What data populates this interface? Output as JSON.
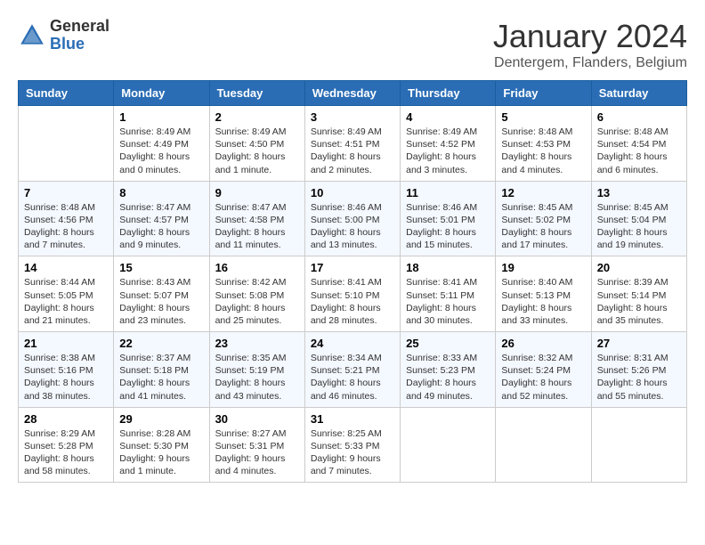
{
  "logo": {
    "general": "General",
    "blue": "Blue"
  },
  "title": "January 2024",
  "location": "Dentergem, Flanders, Belgium",
  "days": [
    "Sunday",
    "Monday",
    "Tuesday",
    "Wednesday",
    "Thursday",
    "Friday",
    "Saturday"
  ],
  "weeks": [
    [
      {
        "date": "",
        "sunrise": "",
        "sunset": "",
        "daylight": ""
      },
      {
        "date": "1",
        "sunrise": "Sunrise: 8:49 AM",
        "sunset": "Sunset: 4:49 PM",
        "daylight": "Daylight: 8 hours and 0 minutes."
      },
      {
        "date": "2",
        "sunrise": "Sunrise: 8:49 AM",
        "sunset": "Sunset: 4:50 PM",
        "daylight": "Daylight: 8 hours and 1 minute."
      },
      {
        "date": "3",
        "sunrise": "Sunrise: 8:49 AM",
        "sunset": "Sunset: 4:51 PM",
        "daylight": "Daylight: 8 hours and 2 minutes."
      },
      {
        "date": "4",
        "sunrise": "Sunrise: 8:49 AM",
        "sunset": "Sunset: 4:52 PM",
        "daylight": "Daylight: 8 hours and 3 minutes."
      },
      {
        "date": "5",
        "sunrise": "Sunrise: 8:48 AM",
        "sunset": "Sunset: 4:53 PM",
        "daylight": "Daylight: 8 hours and 4 minutes."
      },
      {
        "date": "6",
        "sunrise": "Sunrise: 8:48 AM",
        "sunset": "Sunset: 4:54 PM",
        "daylight": "Daylight: 8 hours and 6 minutes."
      }
    ],
    [
      {
        "date": "7",
        "sunrise": "Sunrise: 8:48 AM",
        "sunset": "Sunset: 4:56 PM",
        "daylight": "Daylight: 8 hours and 7 minutes."
      },
      {
        "date": "8",
        "sunrise": "Sunrise: 8:47 AM",
        "sunset": "Sunset: 4:57 PM",
        "daylight": "Daylight: 8 hours and 9 minutes."
      },
      {
        "date": "9",
        "sunrise": "Sunrise: 8:47 AM",
        "sunset": "Sunset: 4:58 PM",
        "daylight": "Daylight: 8 hours and 11 minutes."
      },
      {
        "date": "10",
        "sunrise": "Sunrise: 8:46 AM",
        "sunset": "Sunset: 5:00 PM",
        "daylight": "Daylight: 8 hours and 13 minutes."
      },
      {
        "date": "11",
        "sunrise": "Sunrise: 8:46 AM",
        "sunset": "Sunset: 5:01 PM",
        "daylight": "Daylight: 8 hours and 15 minutes."
      },
      {
        "date": "12",
        "sunrise": "Sunrise: 8:45 AM",
        "sunset": "Sunset: 5:02 PM",
        "daylight": "Daylight: 8 hours and 17 minutes."
      },
      {
        "date": "13",
        "sunrise": "Sunrise: 8:45 AM",
        "sunset": "Sunset: 5:04 PM",
        "daylight": "Daylight: 8 hours and 19 minutes."
      }
    ],
    [
      {
        "date": "14",
        "sunrise": "Sunrise: 8:44 AM",
        "sunset": "Sunset: 5:05 PM",
        "daylight": "Daylight: 8 hours and 21 minutes."
      },
      {
        "date": "15",
        "sunrise": "Sunrise: 8:43 AM",
        "sunset": "Sunset: 5:07 PM",
        "daylight": "Daylight: 8 hours and 23 minutes."
      },
      {
        "date": "16",
        "sunrise": "Sunrise: 8:42 AM",
        "sunset": "Sunset: 5:08 PM",
        "daylight": "Daylight: 8 hours and 25 minutes."
      },
      {
        "date": "17",
        "sunrise": "Sunrise: 8:41 AM",
        "sunset": "Sunset: 5:10 PM",
        "daylight": "Daylight: 8 hours and 28 minutes."
      },
      {
        "date": "18",
        "sunrise": "Sunrise: 8:41 AM",
        "sunset": "Sunset: 5:11 PM",
        "daylight": "Daylight: 8 hours and 30 minutes."
      },
      {
        "date": "19",
        "sunrise": "Sunrise: 8:40 AM",
        "sunset": "Sunset: 5:13 PM",
        "daylight": "Daylight: 8 hours and 33 minutes."
      },
      {
        "date": "20",
        "sunrise": "Sunrise: 8:39 AM",
        "sunset": "Sunset: 5:14 PM",
        "daylight": "Daylight: 8 hours and 35 minutes."
      }
    ],
    [
      {
        "date": "21",
        "sunrise": "Sunrise: 8:38 AM",
        "sunset": "Sunset: 5:16 PM",
        "daylight": "Daylight: 8 hours and 38 minutes."
      },
      {
        "date": "22",
        "sunrise": "Sunrise: 8:37 AM",
        "sunset": "Sunset: 5:18 PM",
        "daylight": "Daylight: 8 hours and 41 minutes."
      },
      {
        "date": "23",
        "sunrise": "Sunrise: 8:35 AM",
        "sunset": "Sunset: 5:19 PM",
        "daylight": "Daylight: 8 hours and 43 minutes."
      },
      {
        "date": "24",
        "sunrise": "Sunrise: 8:34 AM",
        "sunset": "Sunset: 5:21 PM",
        "daylight": "Daylight: 8 hours and 46 minutes."
      },
      {
        "date": "25",
        "sunrise": "Sunrise: 8:33 AM",
        "sunset": "Sunset: 5:23 PM",
        "daylight": "Daylight: 8 hours and 49 minutes."
      },
      {
        "date": "26",
        "sunrise": "Sunrise: 8:32 AM",
        "sunset": "Sunset: 5:24 PM",
        "daylight": "Daylight: 8 hours and 52 minutes."
      },
      {
        "date": "27",
        "sunrise": "Sunrise: 8:31 AM",
        "sunset": "Sunset: 5:26 PM",
        "daylight": "Daylight: 8 hours and 55 minutes."
      }
    ],
    [
      {
        "date": "28",
        "sunrise": "Sunrise: 8:29 AM",
        "sunset": "Sunset: 5:28 PM",
        "daylight": "Daylight: 8 hours and 58 minutes."
      },
      {
        "date": "29",
        "sunrise": "Sunrise: 8:28 AM",
        "sunset": "Sunset: 5:30 PM",
        "daylight": "Daylight: 9 hours and 1 minute."
      },
      {
        "date": "30",
        "sunrise": "Sunrise: 8:27 AM",
        "sunset": "Sunset: 5:31 PM",
        "daylight": "Daylight: 9 hours and 4 minutes."
      },
      {
        "date": "31",
        "sunrise": "Sunrise: 8:25 AM",
        "sunset": "Sunset: 5:33 PM",
        "daylight": "Daylight: 9 hours and 7 minutes."
      },
      {
        "date": "",
        "sunrise": "",
        "sunset": "",
        "daylight": ""
      },
      {
        "date": "",
        "sunrise": "",
        "sunset": "",
        "daylight": ""
      },
      {
        "date": "",
        "sunrise": "",
        "sunset": "",
        "daylight": ""
      }
    ]
  ]
}
